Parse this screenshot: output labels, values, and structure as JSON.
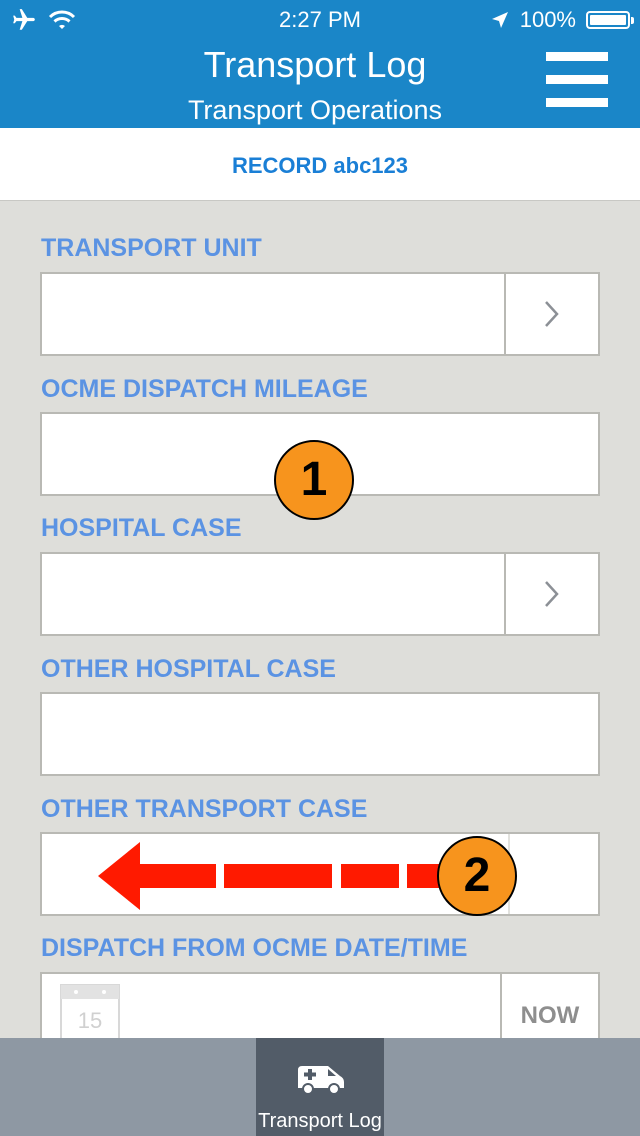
{
  "status_bar": {
    "time": "2:27 PM",
    "battery_text": "100%",
    "icons": [
      "airplane-icon",
      "wifi-icon",
      "location-arrow-icon",
      "battery-icon"
    ]
  },
  "header": {
    "title": "Transport Log",
    "subtitle": "Transport Operations",
    "menu_icon": "hamburger-menu-icon",
    "color": "#1a86c8"
  },
  "record": {
    "label": "RECORD abc123"
  },
  "fields": {
    "transport_unit": {
      "label": "TRANSPORT UNIT",
      "value": ""
    },
    "ocme_dispatch_mileage": {
      "label": "OCME DISPATCH MILEAGE",
      "value": ""
    },
    "hospital_case": {
      "label": "HOSPITAL CASE",
      "value": ""
    },
    "other_hospital_case": {
      "label": "OTHER HOSPITAL CASE",
      "value": ""
    },
    "other_transport_case": {
      "label": "OTHER TRANSPORT CASE",
      "value": ""
    },
    "dispatch_datetime": {
      "label": "DISPATCH FROM OCME DATE/TIME",
      "calendar_day": "15",
      "now_label": "NOW"
    }
  },
  "annotations": [
    {
      "label": "1"
    },
    {
      "label": "2"
    }
  ],
  "annotation_colors": {
    "callout": "#f7941d",
    "arrow": "#ff1a00"
  },
  "label_color": "#5b93e3",
  "tab_bar": {
    "items": [
      {
        "label": "Transport Log",
        "icon": "ambulance-icon",
        "selected": true
      }
    ]
  }
}
